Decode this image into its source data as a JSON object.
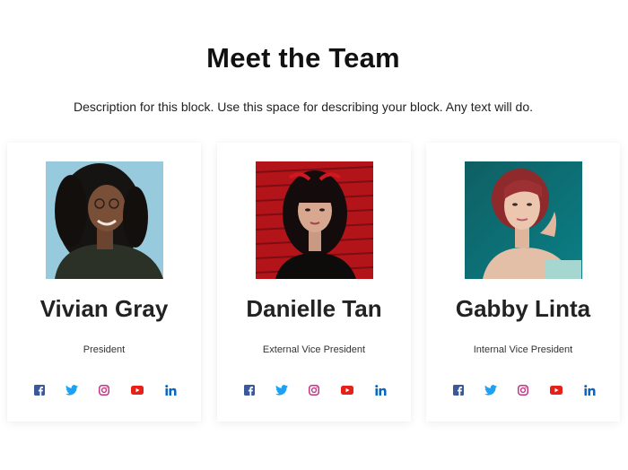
{
  "section": {
    "title": "Meet the Team",
    "description": "Description for this block. Use this space for describing your block. Any text will do."
  },
  "members": [
    {
      "name": "Vivian Gray",
      "role": "President",
      "photo": "portrait-photo",
      "socials": [
        "facebook-icon",
        "twitter-icon",
        "instagram-icon",
        "youtube-icon",
        "linkedin-icon"
      ]
    },
    {
      "name": "Danielle Tan",
      "role": "External Vice President",
      "photo": "portrait-photo",
      "socials": [
        "facebook-icon",
        "twitter-icon",
        "instagram-icon",
        "youtube-icon",
        "linkedin-icon"
      ]
    },
    {
      "name": "Gabby Linta",
      "role": "Internal Vice President",
      "photo": "portrait-photo",
      "socials": [
        "facebook-icon",
        "twitter-icon",
        "instagram-icon",
        "youtube-icon",
        "linkedin-icon"
      ]
    }
  ],
  "colors": {
    "facebook": "#3b5998",
    "twitter": "#1da1f2",
    "instagram": "#c13584",
    "youtube": "#e62117",
    "linkedin": "#0a66c2"
  }
}
